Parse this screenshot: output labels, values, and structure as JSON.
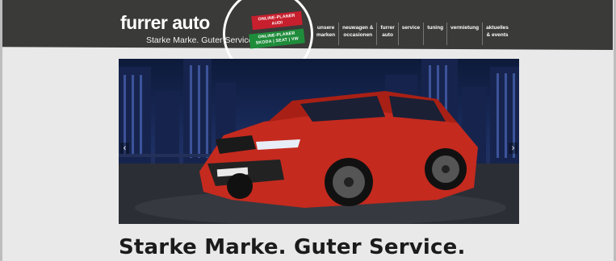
{
  "brand": {
    "name": "furrer auto",
    "tagline": "Starke Marke. Guter Service."
  },
  "badges": {
    "audi": {
      "line1": "ONLINE-PLANER",
      "line2": "AUDI",
      "color": "#c71f2d"
    },
    "skoda": {
      "line1": "ONLINE-PLANER",
      "line2": "SKODA | SEAT | VW",
      "color": "#1e8c3a"
    }
  },
  "nav": [
    {
      "line1": "unsere",
      "line2": "marken"
    },
    {
      "line1": "neuwagen &",
      "line2": "occasionen"
    },
    {
      "line1": "furrer",
      "line2": "auto"
    },
    {
      "line1": "service",
      "line2": ""
    },
    {
      "line1": "tuning",
      "line2": ""
    },
    {
      "line1": "vermietung",
      "line2": ""
    },
    {
      "line1": "aktuelles",
      "line2": "& events"
    }
  ],
  "hero": {
    "plate_text": "Octavia RS",
    "prev_arrow": "‹",
    "next_arrow": "›"
  },
  "headline": "Starke Marke. Guter Service.",
  "colors": {
    "header_bg": "#3a3a38",
    "page_bg": "#e9e9e9",
    "car_red": "#c52a1e"
  }
}
